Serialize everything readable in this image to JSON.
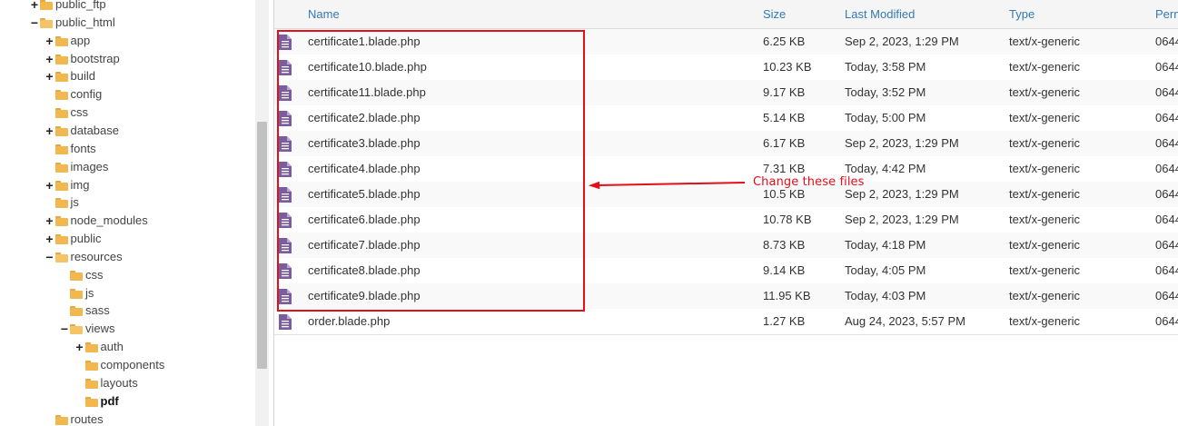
{
  "tree": {
    "items": [
      {
        "label": "public_ftp",
        "toggle": "+",
        "indent": 0
      },
      {
        "label": "public_html",
        "toggle": "−",
        "indent": 0,
        "open": true
      },
      {
        "label": "app",
        "toggle": "+",
        "indent": 1
      },
      {
        "label": "bootstrap",
        "toggle": "+",
        "indent": 1
      },
      {
        "label": "build",
        "toggle": "+",
        "indent": 1
      },
      {
        "label": "config",
        "toggle": "",
        "indent": 1
      },
      {
        "label": "css",
        "toggle": "",
        "indent": 1
      },
      {
        "label": "database",
        "toggle": "+",
        "indent": 1
      },
      {
        "label": "fonts",
        "toggle": "",
        "indent": 1
      },
      {
        "label": "images",
        "toggle": "",
        "indent": 1
      },
      {
        "label": "img",
        "toggle": "+",
        "indent": 1
      },
      {
        "label": "js",
        "toggle": "",
        "indent": 1
      },
      {
        "label": "node_modules",
        "toggle": "+",
        "indent": 1
      },
      {
        "label": "public",
        "toggle": "+",
        "indent": 1
      },
      {
        "label": "resources",
        "toggle": "−",
        "indent": 1,
        "open": true
      },
      {
        "label": "css",
        "toggle": "",
        "indent": 2
      },
      {
        "label": "js",
        "toggle": "",
        "indent": 2
      },
      {
        "label": "sass",
        "toggle": "",
        "indent": 2
      },
      {
        "label": "views",
        "toggle": "−",
        "indent": 2,
        "open": true
      },
      {
        "label": "auth",
        "toggle": "+",
        "indent": 3
      },
      {
        "label": "components",
        "toggle": "",
        "indent": 3
      },
      {
        "label": "layouts",
        "toggle": "",
        "indent": 3
      },
      {
        "label": "pdf",
        "toggle": "",
        "indent": 3,
        "active": true
      },
      {
        "label": "routes",
        "toggle": "",
        "indent": 1
      }
    ]
  },
  "table": {
    "headers": {
      "name": "Name",
      "size": "Size",
      "modified": "Last Modified",
      "type": "Type",
      "perms": "Permissions"
    },
    "rows": [
      {
        "name": "certificate1.blade.php",
        "size": "6.25 KB",
        "modified": "Sep 2, 2023, 1:29 PM",
        "type": "text/x-generic",
        "perms": "0644"
      },
      {
        "name": "certificate10.blade.php",
        "size": "10.23 KB",
        "modified": "Today, 3:58 PM",
        "type": "text/x-generic",
        "perms": "0644"
      },
      {
        "name": "certificate11.blade.php",
        "size": "9.17 KB",
        "modified": "Today, 3:52 PM",
        "type": "text/x-generic",
        "perms": "0644"
      },
      {
        "name": "certificate2.blade.php",
        "size": "5.14 KB",
        "modified": "Today, 5:00 PM",
        "type": "text/x-generic",
        "perms": "0644"
      },
      {
        "name": "certificate3.blade.php",
        "size": "6.17 KB",
        "modified": "Sep 2, 2023, 1:29 PM",
        "type": "text/x-generic",
        "perms": "0644"
      },
      {
        "name": "certificate4.blade.php",
        "size": "7.31 KB",
        "modified": "Today, 4:42 PM",
        "type": "text/x-generic",
        "perms": "0644"
      },
      {
        "name": "certificate5.blade.php",
        "size": "10.5 KB",
        "modified": "Sep 2, 2023, 1:29 PM",
        "type": "text/x-generic",
        "perms": "0644"
      },
      {
        "name": "certificate6.blade.php",
        "size": "10.78 KB",
        "modified": "Sep 2, 2023, 1:29 PM",
        "type": "text/x-generic",
        "perms": "0644"
      },
      {
        "name": "certificate7.blade.php",
        "size": "8.73 KB",
        "modified": "Today, 4:18 PM",
        "type": "text/x-generic",
        "perms": "0644"
      },
      {
        "name": "certificate8.blade.php",
        "size": "9.14 KB",
        "modified": "Today, 4:05 PM",
        "type": "text/x-generic",
        "perms": "0644"
      },
      {
        "name": "certificate9.blade.php",
        "size": "11.95 KB",
        "modified": "Today, 4:03 PM",
        "type": "text/x-generic",
        "perms": "0644"
      },
      {
        "name": "order.blade.php",
        "size": "1.27 KB",
        "modified": "Aug 24, 2023, 5:57 PM",
        "type": "text/x-generic",
        "perms": "0644"
      }
    ]
  },
  "annotation": {
    "text": "Change these files",
    "color": "#e3101a"
  },
  "colors": {
    "header_link": "#337ab7",
    "file_icon": "#7b5c9e",
    "folder": "#f0b84e"
  },
  "icons": {
    "folder": "folder-icon",
    "folder_open": "folder-open-icon",
    "file": "file-icon"
  }
}
